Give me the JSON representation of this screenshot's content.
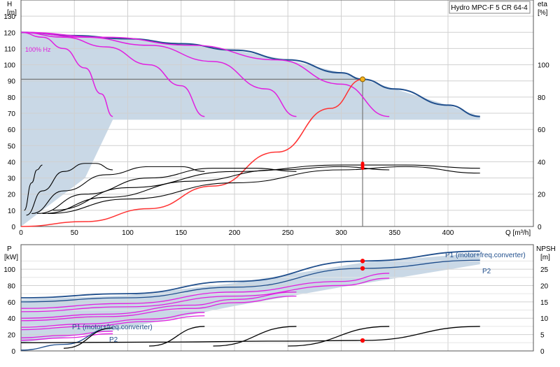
{
  "chart_data": [
    {
      "type": "line",
      "title": "Hydro MPC-F 5 CR 64-4",
      "x_label": "Q [m³/h]",
      "xlim": [
        0,
        480
      ],
      "x_ticks": [
        0,
        50,
        100,
        150,
        200,
        250,
        300,
        350,
        400
      ],
      "left_axis": {
        "name": "H",
        "unit": "[m]",
        "ylim": [
          0,
          140
        ],
        "ticks": [
          0,
          10,
          20,
          30,
          40,
          50,
          60,
          70,
          80,
          90,
          100,
          110,
          120,
          130
        ]
      },
      "right_axis": {
        "name": "eta",
        "unit": "[%]",
        "ylim": [
          0,
          140
        ],
        "ticks": [
          0,
          20,
          40,
          60,
          80,
          100
        ]
      },
      "speed_label": "100% Hz",
      "grid": true,
      "duty_point": {
        "q": 320,
        "h": 91
      },
      "envelope_color": "#c9d8e6",
      "series": [
        {
          "role": "max-curve",
          "color": "#1f4e8c",
          "points": [
            [
              0,
              120
            ],
            [
              50,
              118
            ],
            [
              100,
              116
            ],
            [
              150,
              113
            ],
            [
              200,
              109
            ],
            [
              250,
              103
            ],
            [
              300,
              95
            ],
            [
              320,
              91
            ],
            [
              350,
              85
            ],
            [
              400,
              75
            ],
            [
              430,
              68
            ]
          ]
        },
        {
          "role": "speed-curve",
          "color": "#e020e0",
          "points": [
            [
              0,
              120
            ],
            [
              20,
              117
            ],
            [
              40,
              110
            ],
            [
              60,
              98
            ],
            [
              75,
              82
            ],
            [
              86,
              68
            ]
          ]
        },
        {
          "role": "speed-curve",
          "color": "#e020e0",
          "points": [
            [
              0,
              120
            ],
            [
              40,
              117
            ],
            [
              80,
              111
            ],
            [
              120,
              100
            ],
            [
              150,
              87
            ],
            [
              172,
              68
            ]
          ]
        },
        {
          "role": "speed-curve",
          "color": "#e020e0",
          "points": [
            [
              0,
              120
            ],
            [
              60,
              117
            ],
            [
              120,
              112
            ],
            [
              180,
              102
            ],
            [
              230,
              85
            ],
            [
              258,
              68
            ]
          ]
        },
        {
          "role": "speed-curve",
          "color": "#e020e0",
          "points": [
            [
              0,
              120
            ],
            [
              80,
              117
            ],
            [
              160,
              112
            ],
            [
              240,
              103
            ],
            [
              300,
              88
            ],
            [
              345,
              68
            ]
          ]
        },
        {
          "role": "system-curve",
          "color": "#ff3333",
          "points": [
            [
              0,
              0
            ],
            [
              60,
              3
            ],
            [
              120,
              11
            ],
            [
              180,
              25
            ],
            [
              240,
              46
            ],
            [
              290,
              73
            ],
            [
              320,
              91
            ]
          ]
        },
        {
          "role": "efficiency",
          "color": "#000000",
          "points": [
            [
              3,
              10
            ],
            [
              10,
              27
            ],
            [
              15,
              35
            ],
            [
              20,
              38
            ]
          ]
        },
        {
          "role": "efficiency",
          "color": "#000000",
          "points": [
            [
              5,
              7
            ],
            [
              20,
              22
            ],
            [
              40,
              34
            ],
            [
              60,
              39
            ],
            [
              70,
              39
            ],
            [
              86,
              35
            ]
          ]
        },
        {
          "role": "efficiency",
          "color": "#000000",
          "points": [
            [
              10,
              8
            ],
            [
              40,
              22
            ],
            [
              80,
              32
            ],
            [
              120,
              37
            ],
            [
              150,
              37
            ],
            [
              172,
              34
            ]
          ]
        },
        {
          "role": "efficiency",
          "color": "#000000",
          "points": [
            [
              15,
              8
            ],
            [
              60,
              20
            ],
            [
              120,
              30
            ],
            [
              180,
              36
            ],
            [
              220,
              36
            ],
            [
              258,
              34
            ]
          ]
        },
        {
          "role": "efficiency",
          "color": "#000000",
          "points": [
            [
              20,
              8
            ],
            [
              80,
              18
            ],
            [
              160,
              28
            ],
            [
              240,
              35
            ],
            [
              300,
              37
            ],
            [
              345,
              35
            ]
          ]
        },
        {
          "role": "efficiency",
          "color": "#000000",
          "points": [
            [
              25,
              8
            ],
            [
              100,
              17
            ],
            [
              200,
              27
            ],
            [
              300,
              35
            ],
            [
              360,
              37
            ],
            [
              430,
              33
            ]
          ]
        },
        {
          "role": "efficiency",
          "color": "#000000",
          "points": [
            [
              30,
              10
            ],
            [
              100,
              24
            ],
            [
              200,
              34
            ],
            [
              300,
              38
            ],
            [
              360,
              38
            ],
            [
              430,
              36
            ]
          ]
        }
      ]
    },
    {
      "type": "line",
      "x_label": "",
      "xlim": [
        0,
        480
      ],
      "left_axis": {
        "name": "P",
        "unit": "[kW]",
        "ylim": [
          0,
          130
        ],
        "ticks": [
          0,
          20,
          40,
          60,
          80,
          100
        ]
      },
      "right_axis": {
        "name": "NPSH",
        "unit": "[m]",
        "ylim": [
          0,
          32.5
        ],
        "ticks": [
          0,
          5,
          10,
          15,
          20,
          25
        ]
      },
      "labels": {
        "p1_total": "P1 (motor+freq.converter)",
        "p2_total": "P2",
        "p1_single": "P1 (motor+freq.converter)",
        "p2_single": "P2"
      },
      "duty_points": [
        {
          "q": 320,
          "p": 110
        },
        {
          "q": 320,
          "p": 101
        },
        {
          "q": 320,
          "npsh": 3.2
        }
      ],
      "series": [
        {
          "role": "P1-total",
          "color": "#1f4e8c",
          "points": [
            [
              0,
              65
            ],
            [
              100,
              70
            ],
            [
              200,
              85
            ],
            [
              320,
              110
            ],
            [
              430,
              122
            ]
          ]
        },
        {
          "role": "P2-total",
          "color": "#1f4e8c",
          "points": [
            [
              0,
              60
            ],
            [
              100,
              65
            ],
            [
              200,
              78
            ],
            [
              320,
              101
            ],
            [
              430,
              111
            ]
          ]
        },
        {
          "role": "P1-part",
          "color": "#e020e0",
          "points": [
            [
              0,
              52
            ],
            [
              100,
              58
            ],
            [
              200,
              72
            ],
            [
              300,
              85
            ],
            [
              345,
              95
            ]
          ]
        },
        {
          "role": "P2-part",
          "color": "#e020e0",
          "points": [
            [
              0,
              48
            ],
            [
              100,
              54
            ],
            [
              200,
              67
            ],
            [
              300,
              80
            ],
            [
              345,
              89
            ]
          ]
        },
        {
          "role": "P1-part",
          "color": "#e020e0",
          "points": [
            [
              0,
              40
            ],
            [
              80,
              45
            ],
            [
              160,
              56
            ],
            [
              200,
              63
            ],
            [
              258,
              72
            ]
          ]
        },
        {
          "role": "P2-part",
          "color": "#e020e0",
          "points": [
            [
              0,
              37
            ],
            [
              80,
              42
            ],
            [
              160,
              52
            ],
            [
              200,
              59
            ],
            [
              258,
              67
            ]
          ]
        },
        {
          "role": "P1-part",
          "color": "#e020e0",
          "points": [
            [
              0,
              29
            ],
            [
              60,
              33
            ],
            [
              120,
              39
            ],
            [
              172,
              47
            ]
          ]
        },
        {
          "role": "P2-part",
          "color": "#e020e0",
          "points": [
            [
              0,
              26
            ],
            [
              60,
              30
            ],
            [
              120,
              36
            ],
            [
              172,
              43
            ]
          ]
        },
        {
          "role": "P1-part",
          "color": "#e020e0",
          "points": [
            [
              0,
              16
            ],
            [
              40,
              19
            ],
            [
              86,
              24
            ]
          ]
        },
        {
          "role": "P2-part",
          "color": "#e020e0",
          "points": [
            [
              0,
              13
            ],
            [
              40,
              16
            ],
            [
              86,
              21
            ]
          ]
        },
        {
          "role": "P1-single",
          "color": "#1f4e8c",
          "points": [
            [
              0,
              1
            ],
            [
              40,
              8
            ],
            [
              86,
              28
            ]
          ]
        },
        {
          "role": "NPSH",
          "color": "#000000",
          "points": [
            [
              0,
              2.5
            ],
            [
              120,
              2.7
            ],
            [
              250,
              3.0
            ],
            [
              320,
              3.2
            ],
            [
              430,
              7.5
            ]
          ]
        },
        {
          "role": "NPSH",
          "color": "#000000",
          "points": [
            [
              120,
              1.5
            ],
            [
              172,
              7.5
            ]
          ]
        },
        {
          "role": "NPSH",
          "color": "#000000",
          "points": [
            [
              180,
              1.5
            ],
            [
              258,
              7.5
            ]
          ]
        },
        {
          "role": "NPSH",
          "color": "#000000",
          "points": [
            [
              250,
              1.5
            ],
            [
              345,
              7.5
            ]
          ]
        },
        {
          "role": "NPSH",
          "color": "#000000",
          "points": [
            [
              40,
              0.8
            ],
            [
              86,
              7.0
            ]
          ]
        }
      ]
    }
  ]
}
